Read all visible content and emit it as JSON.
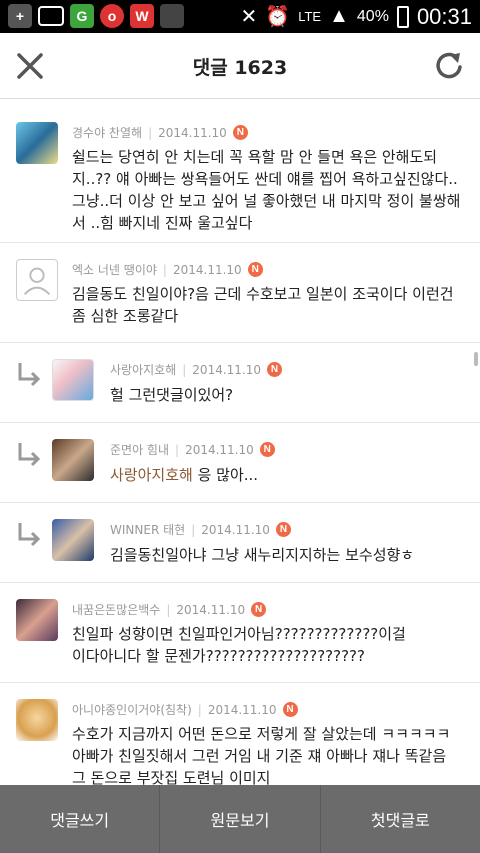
{
  "status_bar": {
    "time": "00:31",
    "battery": "40%",
    "network": "LTE"
  },
  "header": {
    "title": "댓글 1623"
  },
  "comments": [
    {
      "author": "경수야 찬열해",
      "date": "2014.11.10",
      "badge": "N",
      "text": "쉴드는 당연히 안 치는데 꼭 욕할 맘 안 들면 욕은 안해도되지..?? 얘 아빠는 쌍욕들어도 싼데 얘를 찝어 욕하고싶진않다..그냥..더 이상 안 보고 싶어 널 좋아했던 내 마지막 정이 불쌍해서 ..힘 빠지네 진짜 울고싶다"
    },
    {
      "author": "엑소 너넨 땡이야",
      "date": "2014.11.10",
      "badge": "N",
      "text": "김을동도 친일이야?음 근데 수호보고 일본이 조국이다 이런건 좀 심한 조롱같다"
    },
    {
      "author": "사랑아지호해",
      "date": "2014.11.10",
      "badge": "N",
      "text": "헐 그런댓글이있어?"
    },
    {
      "author": "준면아 힘내",
      "date": "2014.11.10",
      "badge": "N",
      "mention": "사랑아지호해",
      "text": " 응 많아..."
    },
    {
      "author": "WINNER 태현",
      "date": "2014.11.10",
      "badge": "N",
      "text": "김을동친일아냐 그냥 새누리지지하는 보수성향ㅎ"
    },
    {
      "author": "내꿈은돈많은백수",
      "date": "2014.11.10",
      "badge": "N",
      "text": "친일파 성향이면 친일파인거아님?????????????이걸 이다아니다 할 문젠가????????????????????"
    },
    {
      "author": "아니야종인이거야(침착)",
      "date": "2014.11.10",
      "badge": "N",
      "text": "수호가 지금까지 어떤 돈으로 저렇게 잘 살았는데 ㅋㅋㅋㅋㅋ 아빠가 친일짓해서 그런 거임 내 기준 쟤 아빠나 쟤나 똑같음 그 돈으로 부잣집 도련님 이미지"
    }
  ],
  "bottom_bar": {
    "write": "댓글쓰기",
    "original": "원문보기",
    "first": "첫댓글로"
  },
  "colors": {
    "badge": "#ef6a45",
    "bottom_bar": "#6b6b6b",
    "mention": "#8b5a35"
  }
}
